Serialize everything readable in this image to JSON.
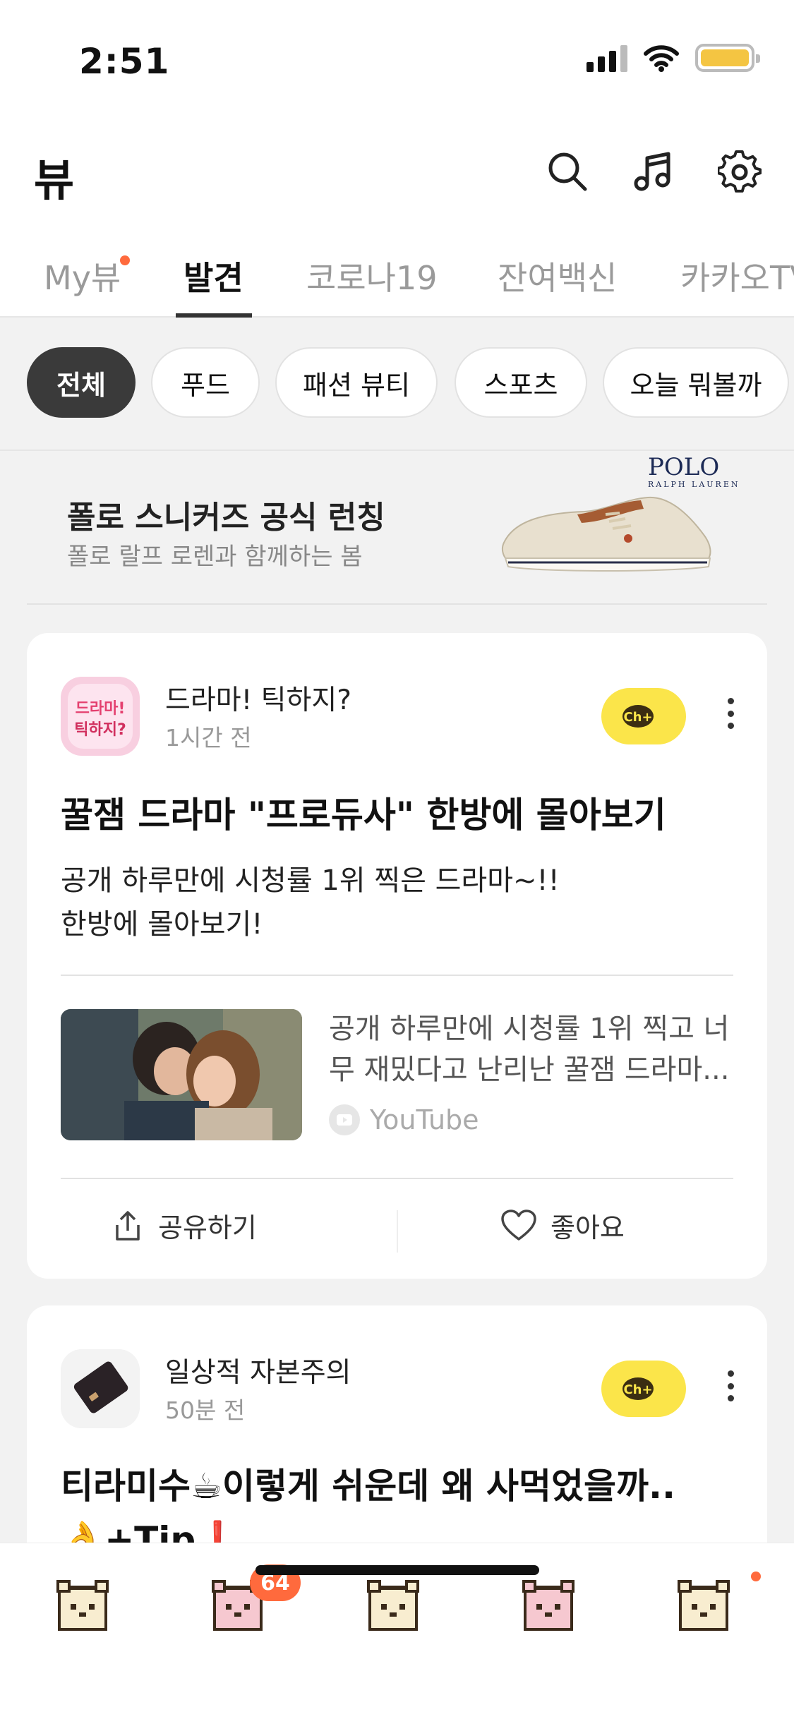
{
  "status_bar": {
    "time": "2:51"
  },
  "header": {
    "title": "뷰"
  },
  "tabs": [
    "My뷰",
    "발견",
    "코로나19",
    "잔여백신",
    "카카오TV"
  ],
  "chips": [
    "전체",
    "푸드",
    "패션 뷰티",
    "스포츠",
    "오늘 뭐볼까"
  ],
  "ad": {
    "title": "폴로 스니커즈 공식 런칭",
    "subtitle": "폴로 랄프 로렌과 함께하는 봄",
    "brand": "POLO",
    "brand_sub": "RALPH LAUREN"
  },
  "posts": [
    {
      "channel": "드라마! 틱하지?",
      "time": "1시간 전",
      "avatar_text_1": "드라마!",
      "avatar_text_2": "틱하지?",
      "title": "꿀잼 드라마 \"프로듀사\" 한방에 몰아보기",
      "desc_line1": "공개 하루만에 시청률 1위 찍은 드라마~!!",
      "desc_line2": "한방에 몰아보기!",
      "link_text_line1": "공개 하루만에 시청률 1위 찍고 너",
      "link_text_line2": "무 재밌다고 난리난 꿀잼 드라마...",
      "link_source": "YouTube",
      "share_label": "공유하기",
      "like_label": "좋아요"
    },
    {
      "channel": "일상적 자본주의",
      "time": "50분 전",
      "title_line1": "티라미수☕이렇게 쉬운데 왜 사먹었을까..",
      "title_line2": "👌+Tip❗"
    }
  ],
  "channel_add_label": "Ch+",
  "bottom_bar": {
    "badge_count": "64"
  },
  "colors": {
    "accent_yellow": "#fbe54a",
    "badge": "#ff6a3d",
    "chip_active": "#3a3a3a"
  }
}
